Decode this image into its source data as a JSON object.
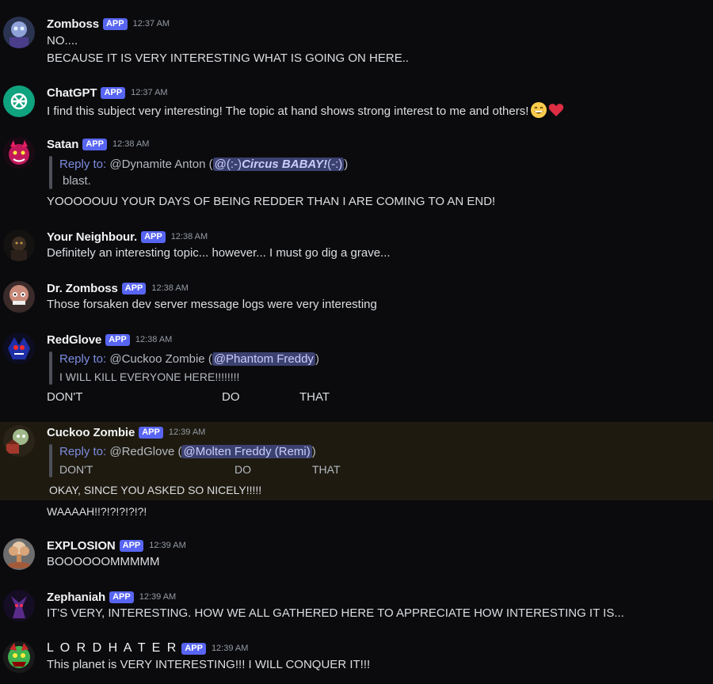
{
  "messages": [
    {
      "user": "Zomboss",
      "badge": "APP",
      "time": "12:37 AM",
      "lines": [
        "NO....",
        "BECAUSE IT IS VERY INTERESTING WHAT IS GOING ON HERE.."
      ]
    },
    {
      "user": "ChatGPT",
      "badge": "APP",
      "time": "12:37 AM",
      "lines": [
        "I find this subject very interesting! The topic at hand shows strong interest to me and others!"
      ]
    },
    {
      "user": "Satan",
      "badge": "APP",
      "time": "12:38 AM",
      "reply": {
        "label": "Reply to:",
        "who": "@Dynamite Anton (",
        "mention_a": "@(:-)",
        "mention_b": "Circus BABAY!",
        "mention_c": "(-:)",
        "close": ")",
        "quote": "blast."
      },
      "lines": [
        "YOOOOOUU YOUR DAYS OF BEING REDDER THAN I ARE COMING TO AN END!"
      ]
    },
    {
      "user": "Your Neighbour.",
      "badge": "APP",
      "time": "12:38 AM",
      "lines": [
        "Definitely an interesting topic... however... I must go dig a grave..."
      ]
    },
    {
      "user": "Dr. Zomboss",
      "badge": "APP",
      "time": "12:38 AM",
      "lines": [
        "Those forsaken dev server message logs were very interesting"
      ]
    },
    {
      "user": "RedGlove",
      "badge": "APP",
      "time": "12:38 AM",
      "reply": {
        "label": "Reply to:",
        "who": "@Cuckoo Zombie (",
        "mention": "@Phantom Freddy",
        "close": ")",
        "quote": "I WILL KILL EVERYONE HERE!!!!!!!!"
      },
      "lines": [
        "DON'T",
        "DO",
        "THAT"
      ]
    },
    {
      "user": "Cuckoo Zombie",
      "badge": "APP",
      "time": "12:39 AM",
      "reply": {
        "label": "Reply to:",
        "who": "@RedGlove (",
        "mention": "@Molten Freddy (Remi)",
        "close": ")",
        "quote": [
          "DON'T",
          "DO",
          "THAT"
        ]
      },
      "lines": [
        "OKAY, SINCE YOU ASKED SO NICELY!!!!!",
        "WAAAAH!!?!?!?!?!?!"
      ]
    },
    {
      "user": "EXPLOSION",
      "badge": "APP",
      "time": "12:39 AM",
      "lines": [
        "BOOOOOOMMMMM"
      ]
    },
    {
      "user": "Zephaniah",
      "badge": "APP",
      "time": "12:39 AM",
      "lines": [
        "IT'S VERY, INTERESTING. HOW WE ALL GATHERED HERE TO APPRECIATE HOW INTERESTING IT IS..."
      ]
    },
    {
      "user": "L O R D  H A T E R",
      "badge": "APP",
      "time": "12:39 AM",
      "lines": [
        "This planet is VERY INTERESTING!!! I WILL CONQUER IT!!!"
      ]
    }
  ],
  "icons": {
    "grin": "grinning-face-icon",
    "heart": "red-heart-icon"
  }
}
